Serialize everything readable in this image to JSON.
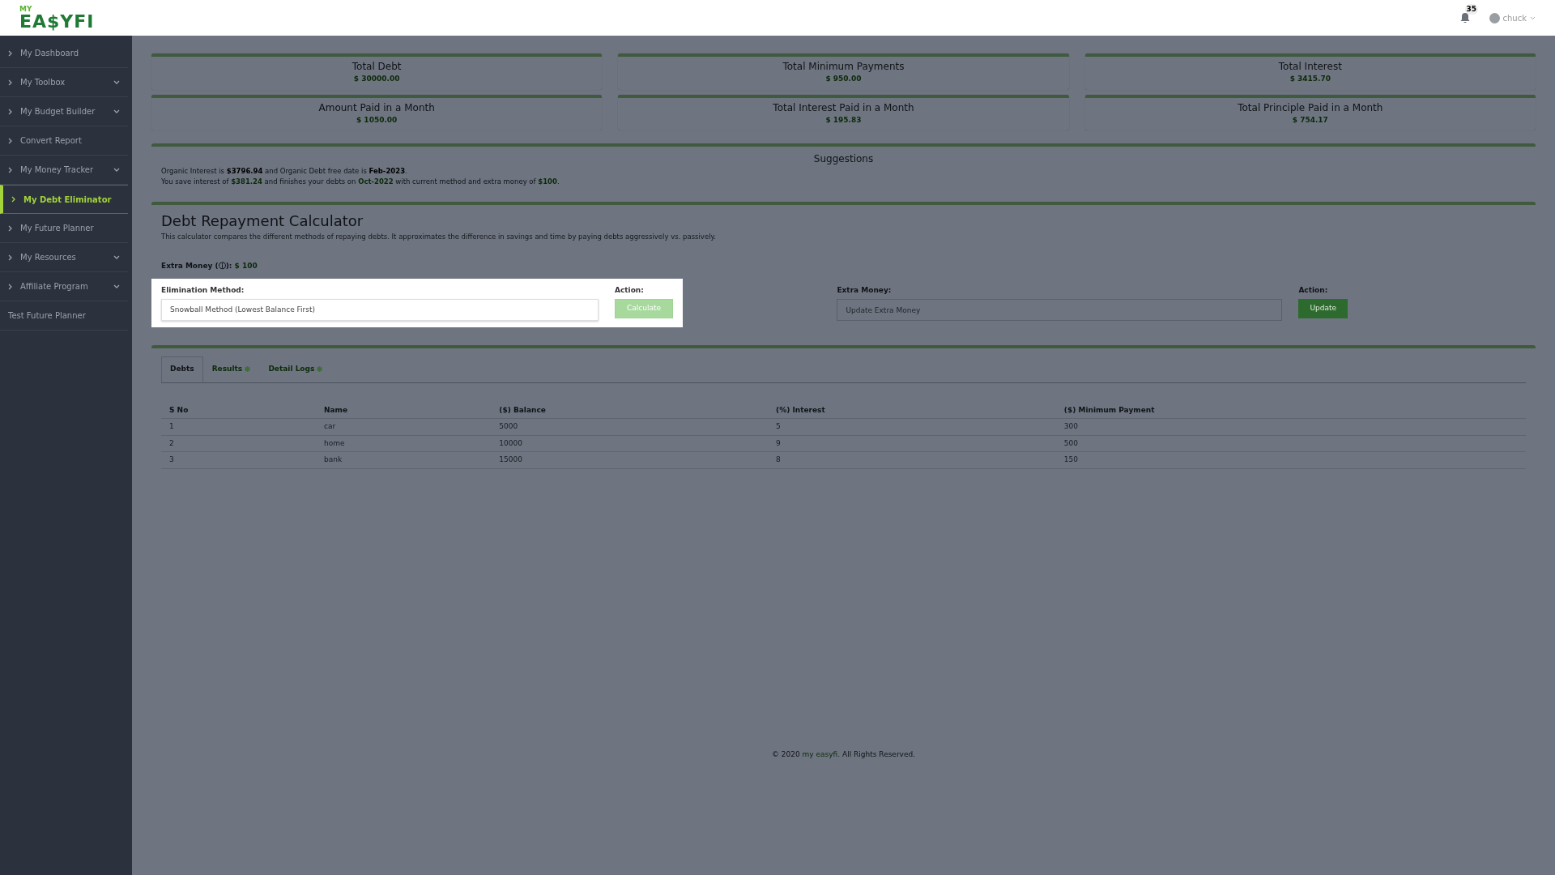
{
  "header": {
    "logo_small": "MY",
    "logo_main": "EA$YFI",
    "notifications": "35",
    "user": "chuck"
  },
  "sidebar": {
    "items": [
      {
        "label": "My Dashboard",
        "expandable": false,
        "selected": false,
        "chevron": true
      },
      {
        "label": "My Toolbox",
        "expandable": true,
        "selected": false,
        "chevron": true
      },
      {
        "label": "My Budget Builder",
        "expandable": true,
        "selected": false,
        "chevron": true
      },
      {
        "label": "Convert Report",
        "expandable": false,
        "selected": false,
        "chevron": true
      },
      {
        "label": "My Money Tracker",
        "expandable": true,
        "selected": false,
        "chevron": true
      },
      {
        "label": "My Debt Eliminator",
        "expandable": false,
        "selected": true,
        "chevron": true
      },
      {
        "label": "My Future Planner",
        "expandable": false,
        "selected": false,
        "chevron": true
      },
      {
        "label": "My Resources",
        "expandable": true,
        "selected": false,
        "chevron": true
      },
      {
        "label": "Affiliate Program",
        "expandable": true,
        "selected": false,
        "chevron": true
      },
      {
        "label": "Test Future Planner",
        "expandable": false,
        "selected": false,
        "chevron": false
      }
    ]
  },
  "stats": [
    {
      "label": "Total Debt",
      "value": "$ 30000.00"
    },
    {
      "label": "Total Minimum Payments",
      "value": "$ 950.00"
    },
    {
      "label": "Total Interest",
      "value": "$ 3415.70"
    },
    {
      "label": "Amount Paid in a Month",
      "value": "$ 1050.00"
    },
    {
      "label": "Total Interest Paid in a Month",
      "value": "$ 195.83"
    },
    {
      "label": "Total Principle Paid in a Month",
      "value": "$ 754.17"
    }
  ],
  "suggestions": {
    "title": "Suggestions",
    "lines": [
      {
        "text": "Organic Interest is **$3796.94** and Organic Debt free date is **Feb-2023**.",
        "color": "#000000"
      },
      {
        "text": "You save interest of **$381.24** and finishes your debts on **Oct-2022** with current method and extra money of **$100**.",
        "color": "#0c2a09"
      }
    ]
  },
  "calculator": {
    "title": "Debt Repayment Calculator",
    "description": "This calculator compares the different methods of repaying debts. It approximates the difference in savings and time by paying debts aggressively vs. passively.",
    "extra_label": "Extra Money (ⓘ):",
    "extra_value": "$ 100",
    "method_label": "Elimination Method:",
    "method_value": "Snowball Method (Lowest Balance First)",
    "action_label": "Action:",
    "calculate": "Calculate",
    "extra_field_label": "Extra Money:",
    "extra_placeholder": "Update Extra Money",
    "action_label_2": "Action:",
    "update": "Update"
  },
  "tabs": [
    {
      "label": "Debts",
      "selected": true,
      "icon": false
    },
    {
      "label": "Results",
      "selected": false,
      "icon": true
    },
    {
      "label": "Detail Logs",
      "selected": false,
      "icon": true
    }
  ],
  "table": {
    "columns": [
      "S No",
      "Name",
      "($) Balance",
      "(%) Interest",
      "($) Minimum Payment"
    ],
    "rows": [
      [
        "1",
        "car",
        "5000",
        "5",
        "300"
      ],
      [
        "2",
        "home",
        "10000",
        "9",
        "500"
      ],
      [
        "3",
        "bank",
        "15000",
        "8",
        "150"
      ]
    ]
  },
  "footer": {
    "before": "© 2020 ",
    "link": "my easyfi",
    "after": ". All Rights Reserved."
  }
}
